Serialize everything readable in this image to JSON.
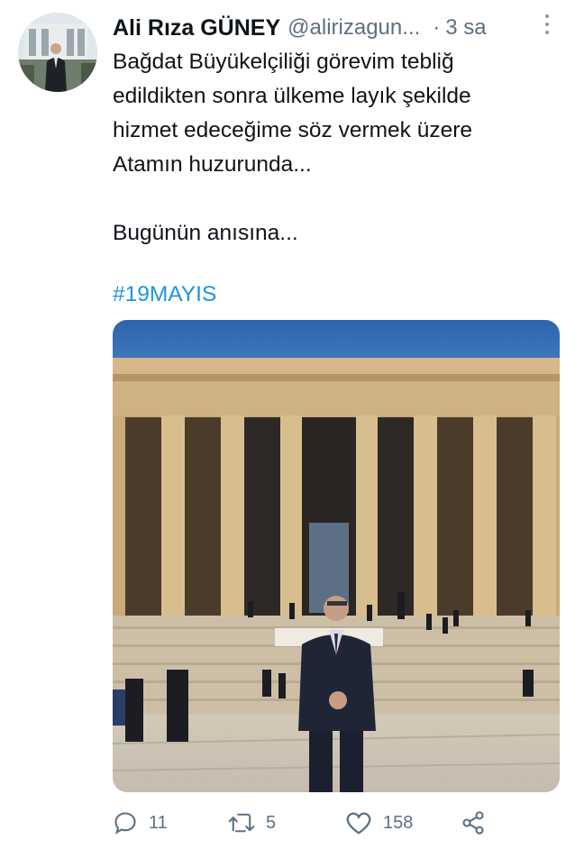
{
  "tweet": {
    "author_name": "Ali Rıza GÜNEY",
    "handle": "@alirizagun...",
    "separator": "·",
    "time": "3 sa",
    "text_lines": [
      "Bağdat Büyükelçiliği görevim tebliğ",
      "edildikten sonra ülkeme layık şekilde",
      "hizmet edeceğime söz vermek üzere",
      "Atamın huzurunda..."
    ],
    "text_line2": "Bugünün anısına...",
    "hashtag": "#19MAYIS",
    "media_icon": "photo-mausoleum"
  },
  "actions": {
    "reply_count": "11",
    "retweet_count": "5",
    "like_count": "158",
    "icons": [
      "reply-icon",
      "retweet-icon",
      "like-icon",
      "share-icon"
    ]
  },
  "colors": {
    "link": "#1b95e0",
    "secondary": "#5b7083",
    "text": "#0f1419"
  }
}
